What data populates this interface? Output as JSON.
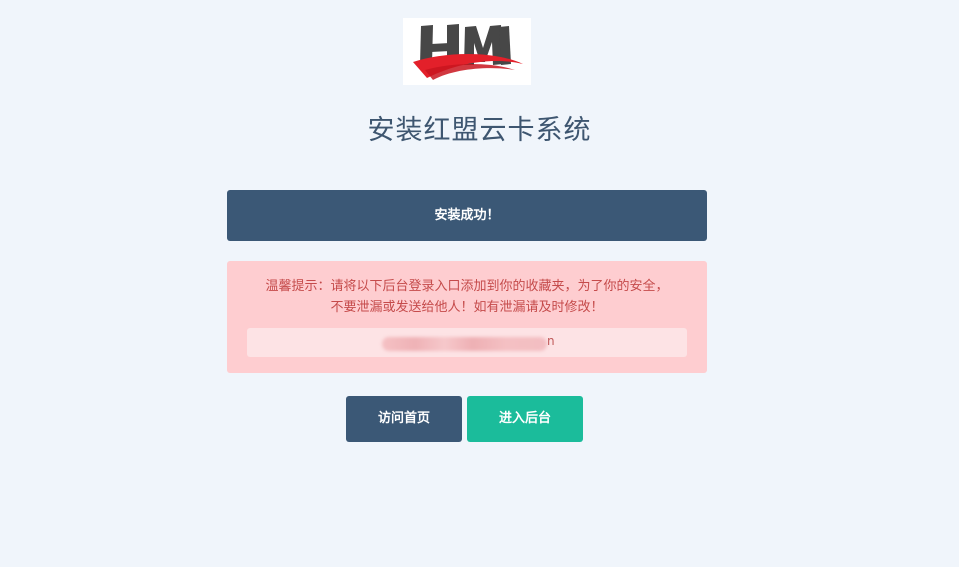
{
  "logo": {
    "text": "HM",
    "colors": {
      "letters": "#444444",
      "swoosh": "#e3202a"
    }
  },
  "page": {
    "title": "安装红盟云卡系统"
  },
  "status": {
    "message": "安装成功！"
  },
  "notice": {
    "line1": "温馨提示：请将以下后台登录入口添加到你的收藏夹，为了你的安全，",
    "line2": "不要泄漏或发送给他人！如有泄漏请及时修改！",
    "url_visible_suffix": "n"
  },
  "buttons": {
    "home_label": "访问首页",
    "admin_label": "进入后台"
  },
  "colors": {
    "primary": "#3b5876",
    "accent": "#1bbc9b",
    "warning_bg": "#fecdd0",
    "warning_text": "#c54b4b",
    "background": "#f0f5fb"
  }
}
